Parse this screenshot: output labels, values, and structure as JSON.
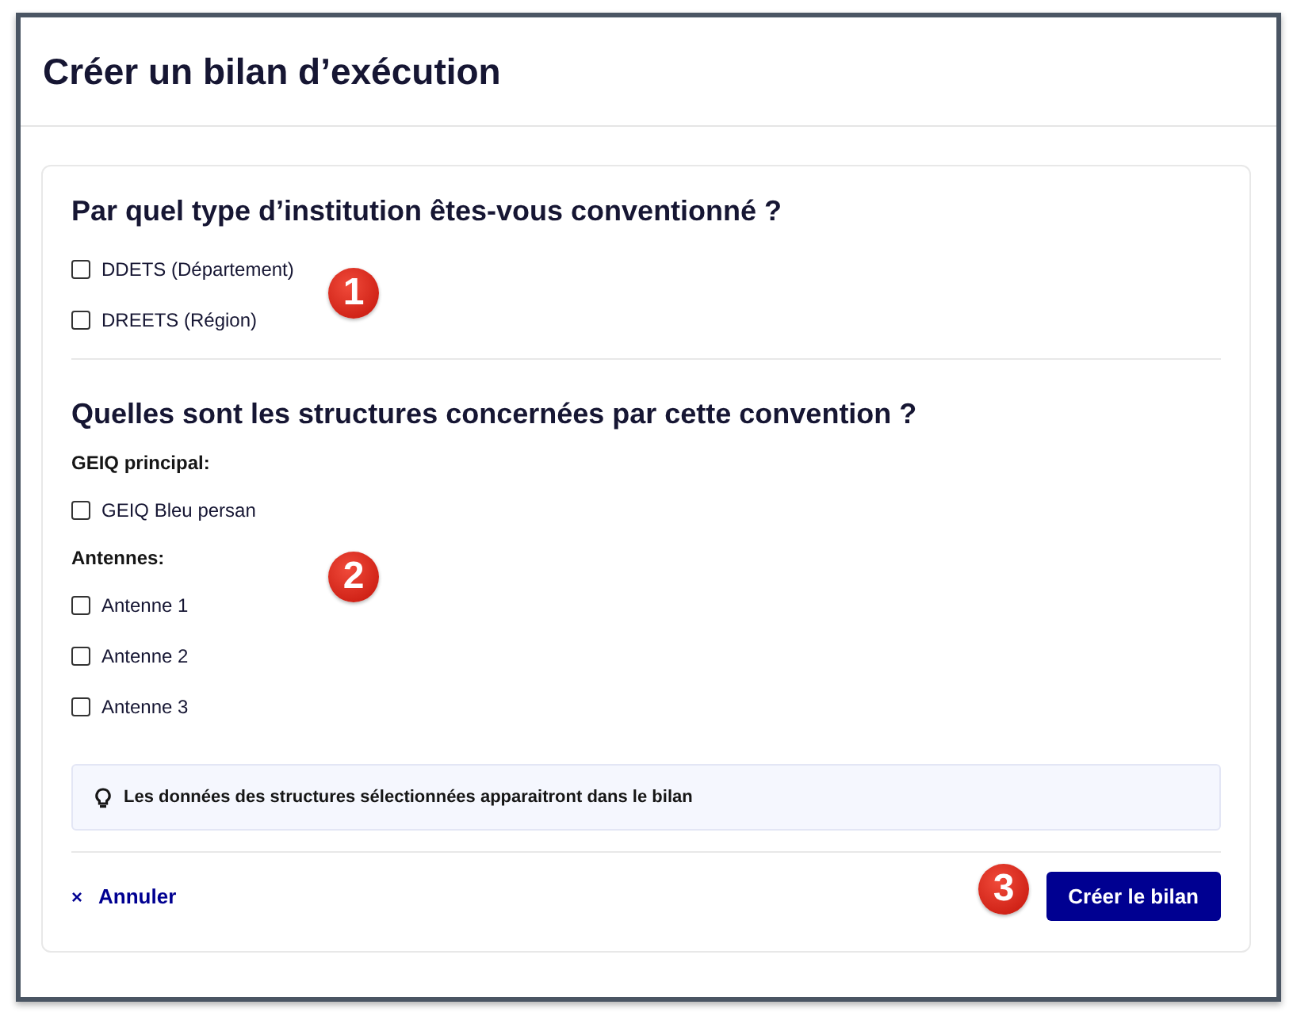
{
  "window": {
    "title": "Créer un bilan d’exécution"
  },
  "institution": {
    "heading": "Par quel type d’institution êtes-vous conventionné ?",
    "options": [
      {
        "label": "DDETS (Département)",
        "checked": false
      },
      {
        "label": "DREETS (Région)",
        "checked": false
      }
    ]
  },
  "structures": {
    "heading": "Quelles sont les structures concernées par cette convention ?",
    "groups": [
      {
        "label": "GEIQ principal:",
        "options": [
          {
            "label": "GEIQ Bleu persan",
            "checked": false
          }
        ]
      },
      {
        "label": "Antennes:",
        "options": [
          {
            "label": "Antenne 1",
            "checked": false
          },
          {
            "label": "Antenne 2",
            "checked": false
          },
          {
            "label": "Antenne 3",
            "checked": false
          }
        ]
      }
    ]
  },
  "notice": {
    "text": "Les données des structures sélectionnées apparaitront dans le bilan"
  },
  "footer": {
    "cancel": {
      "icon": "×",
      "label": "Annuler"
    },
    "submit": "Créer le bilan"
  },
  "annotations": [
    "1",
    "2",
    "3"
  ]
}
